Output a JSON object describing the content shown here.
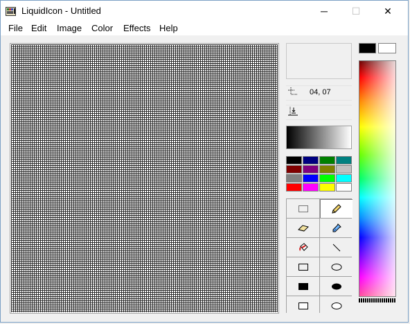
{
  "window": {
    "title": "LiquidIcon - Untitled",
    "app_icon": "liquidicon-app-icon",
    "controls": {
      "minimize": "─",
      "maximize": "☐",
      "close": "✕"
    }
  },
  "menu": [
    {
      "label": "File"
    },
    {
      "label": "Edit"
    },
    {
      "label": "Image"
    },
    {
      "label": "Color"
    },
    {
      "label": "Effects"
    },
    {
      "label": "Help"
    }
  ],
  "status": {
    "cursor_position": "04, 07",
    "cursor_icon": "crosshair-position-icon",
    "size_icon": "image-size-icon"
  },
  "colors": {
    "foreground": "#000000",
    "background": "#ffffff",
    "gray_ramp": [
      "#000000",
      "#ffffff"
    ],
    "palette": [
      "#000000",
      "#000080",
      "#008000",
      "#008080",
      "#800000",
      "#800080",
      "#808000",
      "#c0c0c0",
      "#808080",
      "#0000ff",
      "#00ff00",
      "#00ffff",
      "#ff0000",
      "#ff00ff",
      "#ffff00",
      "#ffffff"
    ]
  },
  "tools": [
    {
      "name": "rectangle-select-tool",
      "icon": "dotted-rectangle-icon"
    },
    {
      "name": "pencil-tool",
      "icon": "pencil-icon",
      "active": true
    },
    {
      "name": "eraser-tool",
      "icon": "eraser-icon"
    },
    {
      "name": "eyedropper-tool",
      "icon": "eyedropper-icon"
    },
    {
      "name": "fill-tool",
      "icon": "paint-bucket-icon"
    },
    {
      "name": "line-tool",
      "icon": "line-icon"
    },
    {
      "name": "rectangle-outline-tool",
      "icon": "rectangle-outline-icon"
    },
    {
      "name": "ellipse-outline-tool",
      "icon": "ellipse-outline-icon"
    },
    {
      "name": "rectangle-filled-tool",
      "icon": "rectangle-filled-icon"
    },
    {
      "name": "ellipse-filled-tool",
      "icon": "ellipse-filled-icon"
    },
    {
      "name": "rectangle-mixed-tool",
      "icon": "rectangle-mixed-icon"
    },
    {
      "name": "ellipse-mixed-tool",
      "icon": "ellipse-mixed-icon"
    }
  ]
}
